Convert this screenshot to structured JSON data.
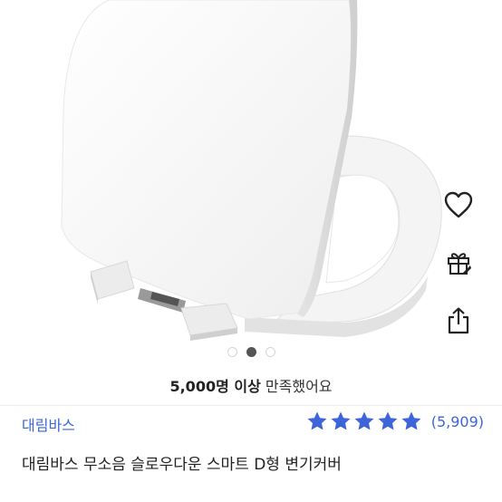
{
  "product": {
    "image_alt": "toilet seat cover"
  },
  "carousel": {
    "total": 3,
    "active_index": 1
  },
  "actions": {
    "wishlist_icon": "heart-icon",
    "gift_icon": "gift-icon",
    "share_icon": "share-icon"
  },
  "satisfaction": {
    "count": "5,000명 이상",
    "suffix": "만족했어요"
  },
  "brand": {
    "name": "대림바스"
  },
  "rating": {
    "stars": 5,
    "star_color": "#3d64d8",
    "review_count": "(5,909)"
  },
  "title": "대림바스 무소음 슬로우다운 스마트 D형 변기커버"
}
